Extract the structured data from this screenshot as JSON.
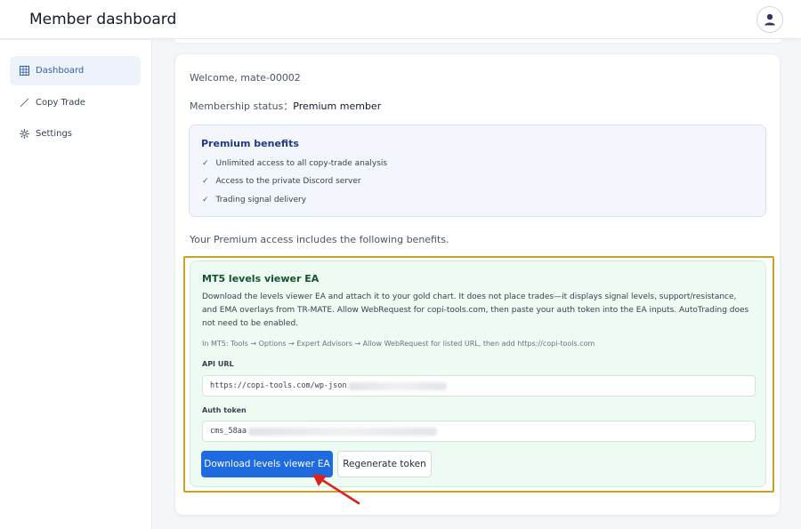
{
  "header": {
    "title": "Member dashboard",
    "avatar_icon": "user-icon"
  },
  "sidebar": {
    "items": [
      {
        "label": "Dashboard",
        "icon": "grid-icon",
        "active": true
      },
      {
        "label": "Copy Trade",
        "icon": "trend-line-icon",
        "active": false
      },
      {
        "label": "Settings",
        "icon": "gear-icon",
        "active": false
      }
    ]
  },
  "main": {
    "welcome": "Welcome, mate-00002",
    "membership_label": "Membership status：",
    "membership_value": "Premium member",
    "benefits": {
      "title": "Premium benefits",
      "items": [
        "Unlimited access to all copy-trade analysis",
        "Access to the private Discord server",
        "Trading signal delivery"
      ]
    },
    "includes_text": "Your Premium access includes the following benefits.",
    "ea": {
      "title": "MT5 levels viewer EA",
      "description": "Download the levels viewer EA and attach it to your gold chart. It does not place trades—it displays signal levels, support/resistance, and EMA overlays from TR-MATE. Allow WebRequest for copi-tools.com, then paste your auth token into the EA inputs. AutoTrading does not need to be enabled.",
      "hint": "In MT5: Tools → Options → Expert Advisors → Allow WebRequest for listed URL, then add https://copi-tools.com",
      "api_url_label": "API URL",
      "api_url_value": "https://copi-tools.com/wp-json",
      "auth_token_label": "Auth token",
      "auth_token_value": "cms_58aa",
      "download_button": "Download levels viewer EA",
      "regenerate_button": "Regenerate token"
    }
  },
  "colors": {
    "accent": "#1e6ae0",
    "highlight_border": "#c9a227",
    "arrow": "#e0201b"
  }
}
